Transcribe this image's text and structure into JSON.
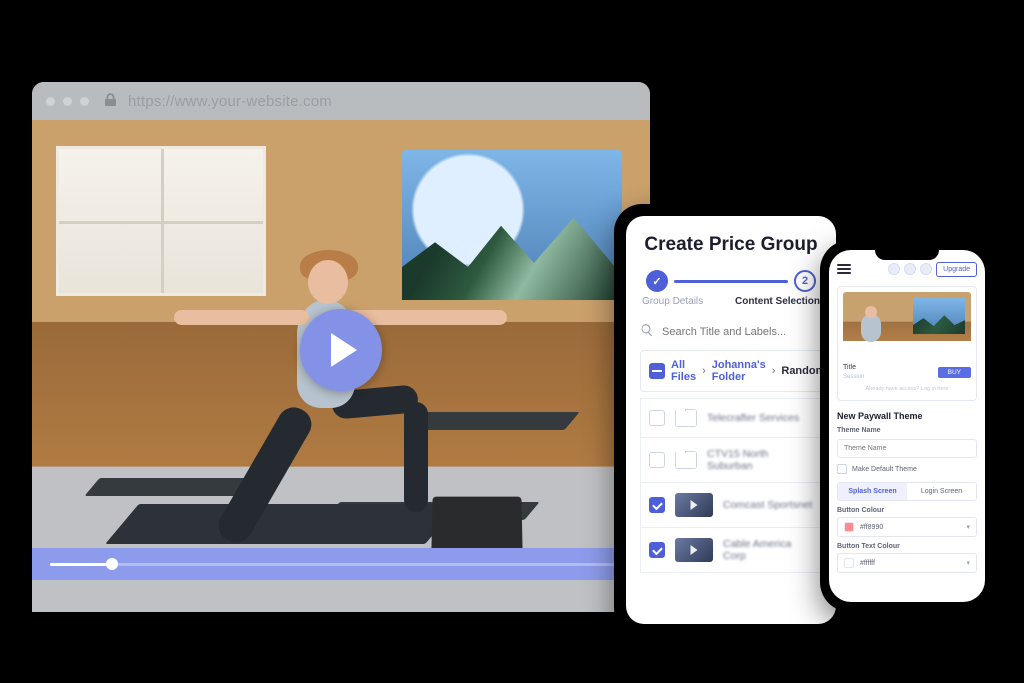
{
  "browser": {
    "url": "https://www.your-website.com"
  },
  "tablet": {
    "title": "Create Price Group",
    "steps": {
      "one": {
        "icon": "✓",
        "label": "Group Details"
      },
      "two": {
        "num": "2",
        "label": "Content Selection"
      }
    },
    "search_placeholder": "Search Title and Labels...",
    "breadcrumb": {
      "root": "All Files",
      "mid": "Johanna's Folder",
      "last": "Random"
    },
    "rows": [
      {
        "label": "Telecrafter Services",
        "checked": false,
        "type": "folder"
      },
      {
        "label": "CTV15 North Suburban",
        "checked": false,
        "type": "folder"
      },
      {
        "label": "Comcast Sportsnet",
        "checked": true,
        "type": "video"
      },
      {
        "label": "Cable America Corp",
        "checked": true,
        "type": "video"
      }
    ]
  },
  "phone": {
    "upgrade": "Upgrade",
    "preview_title": "Title",
    "preview_sub": "Session",
    "buy": "BUY",
    "section_title": "New Paywall Theme",
    "theme_name_label": "Theme Name",
    "theme_name_placeholder": "Theme Name",
    "make_default": "Make Default Theme",
    "tab_splash": "Splash Screen",
    "tab_login": "Login Screen",
    "button_colour_label": "Button Colour",
    "button_colour_value": "#ff8990",
    "button_text_colour_label": "Button Text Colour",
    "button_text_colour_value": "#ffffff"
  }
}
